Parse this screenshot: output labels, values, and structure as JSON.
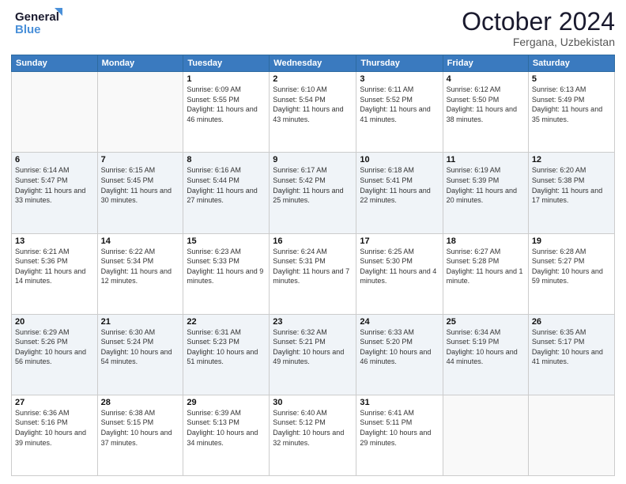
{
  "header": {
    "logo_line1": "General",
    "logo_line2": "Blue",
    "month": "October 2024",
    "location": "Fergana, Uzbekistan"
  },
  "weekdays": [
    "Sunday",
    "Monday",
    "Tuesday",
    "Wednesday",
    "Thursday",
    "Friday",
    "Saturday"
  ],
  "weeks": [
    [
      {
        "day": "",
        "info": ""
      },
      {
        "day": "",
        "info": ""
      },
      {
        "day": "1",
        "info": "Sunrise: 6:09 AM\nSunset: 5:55 PM\nDaylight: 11 hours and 46 minutes."
      },
      {
        "day": "2",
        "info": "Sunrise: 6:10 AM\nSunset: 5:54 PM\nDaylight: 11 hours and 43 minutes."
      },
      {
        "day": "3",
        "info": "Sunrise: 6:11 AM\nSunset: 5:52 PM\nDaylight: 11 hours and 41 minutes."
      },
      {
        "day": "4",
        "info": "Sunrise: 6:12 AM\nSunset: 5:50 PM\nDaylight: 11 hours and 38 minutes."
      },
      {
        "day": "5",
        "info": "Sunrise: 6:13 AM\nSunset: 5:49 PM\nDaylight: 11 hours and 35 minutes."
      }
    ],
    [
      {
        "day": "6",
        "info": "Sunrise: 6:14 AM\nSunset: 5:47 PM\nDaylight: 11 hours and 33 minutes."
      },
      {
        "day": "7",
        "info": "Sunrise: 6:15 AM\nSunset: 5:45 PM\nDaylight: 11 hours and 30 minutes."
      },
      {
        "day": "8",
        "info": "Sunrise: 6:16 AM\nSunset: 5:44 PM\nDaylight: 11 hours and 27 minutes."
      },
      {
        "day": "9",
        "info": "Sunrise: 6:17 AM\nSunset: 5:42 PM\nDaylight: 11 hours and 25 minutes."
      },
      {
        "day": "10",
        "info": "Sunrise: 6:18 AM\nSunset: 5:41 PM\nDaylight: 11 hours and 22 minutes."
      },
      {
        "day": "11",
        "info": "Sunrise: 6:19 AM\nSunset: 5:39 PM\nDaylight: 11 hours and 20 minutes."
      },
      {
        "day": "12",
        "info": "Sunrise: 6:20 AM\nSunset: 5:38 PM\nDaylight: 11 hours and 17 minutes."
      }
    ],
    [
      {
        "day": "13",
        "info": "Sunrise: 6:21 AM\nSunset: 5:36 PM\nDaylight: 11 hours and 14 minutes."
      },
      {
        "day": "14",
        "info": "Sunrise: 6:22 AM\nSunset: 5:34 PM\nDaylight: 11 hours and 12 minutes."
      },
      {
        "day": "15",
        "info": "Sunrise: 6:23 AM\nSunset: 5:33 PM\nDaylight: 11 hours and 9 minutes."
      },
      {
        "day": "16",
        "info": "Sunrise: 6:24 AM\nSunset: 5:31 PM\nDaylight: 11 hours and 7 minutes."
      },
      {
        "day": "17",
        "info": "Sunrise: 6:25 AM\nSunset: 5:30 PM\nDaylight: 11 hours and 4 minutes."
      },
      {
        "day": "18",
        "info": "Sunrise: 6:27 AM\nSunset: 5:28 PM\nDaylight: 11 hours and 1 minute."
      },
      {
        "day": "19",
        "info": "Sunrise: 6:28 AM\nSunset: 5:27 PM\nDaylight: 10 hours and 59 minutes."
      }
    ],
    [
      {
        "day": "20",
        "info": "Sunrise: 6:29 AM\nSunset: 5:26 PM\nDaylight: 10 hours and 56 minutes."
      },
      {
        "day": "21",
        "info": "Sunrise: 6:30 AM\nSunset: 5:24 PM\nDaylight: 10 hours and 54 minutes."
      },
      {
        "day": "22",
        "info": "Sunrise: 6:31 AM\nSunset: 5:23 PM\nDaylight: 10 hours and 51 minutes."
      },
      {
        "day": "23",
        "info": "Sunrise: 6:32 AM\nSunset: 5:21 PM\nDaylight: 10 hours and 49 minutes."
      },
      {
        "day": "24",
        "info": "Sunrise: 6:33 AM\nSunset: 5:20 PM\nDaylight: 10 hours and 46 minutes."
      },
      {
        "day": "25",
        "info": "Sunrise: 6:34 AM\nSunset: 5:19 PM\nDaylight: 10 hours and 44 minutes."
      },
      {
        "day": "26",
        "info": "Sunrise: 6:35 AM\nSunset: 5:17 PM\nDaylight: 10 hours and 41 minutes."
      }
    ],
    [
      {
        "day": "27",
        "info": "Sunrise: 6:36 AM\nSunset: 5:16 PM\nDaylight: 10 hours and 39 minutes."
      },
      {
        "day": "28",
        "info": "Sunrise: 6:38 AM\nSunset: 5:15 PM\nDaylight: 10 hours and 37 minutes."
      },
      {
        "day": "29",
        "info": "Sunrise: 6:39 AM\nSunset: 5:13 PM\nDaylight: 10 hours and 34 minutes."
      },
      {
        "day": "30",
        "info": "Sunrise: 6:40 AM\nSunset: 5:12 PM\nDaylight: 10 hours and 32 minutes."
      },
      {
        "day": "31",
        "info": "Sunrise: 6:41 AM\nSunset: 5:11 PM\nDaylight: 10 hours and 29 minutes."
      },
      {
        "day": "",
        "info": ""
      },
      {
        "day": "",
        "info": ""
      }
    ]
  ]
}
